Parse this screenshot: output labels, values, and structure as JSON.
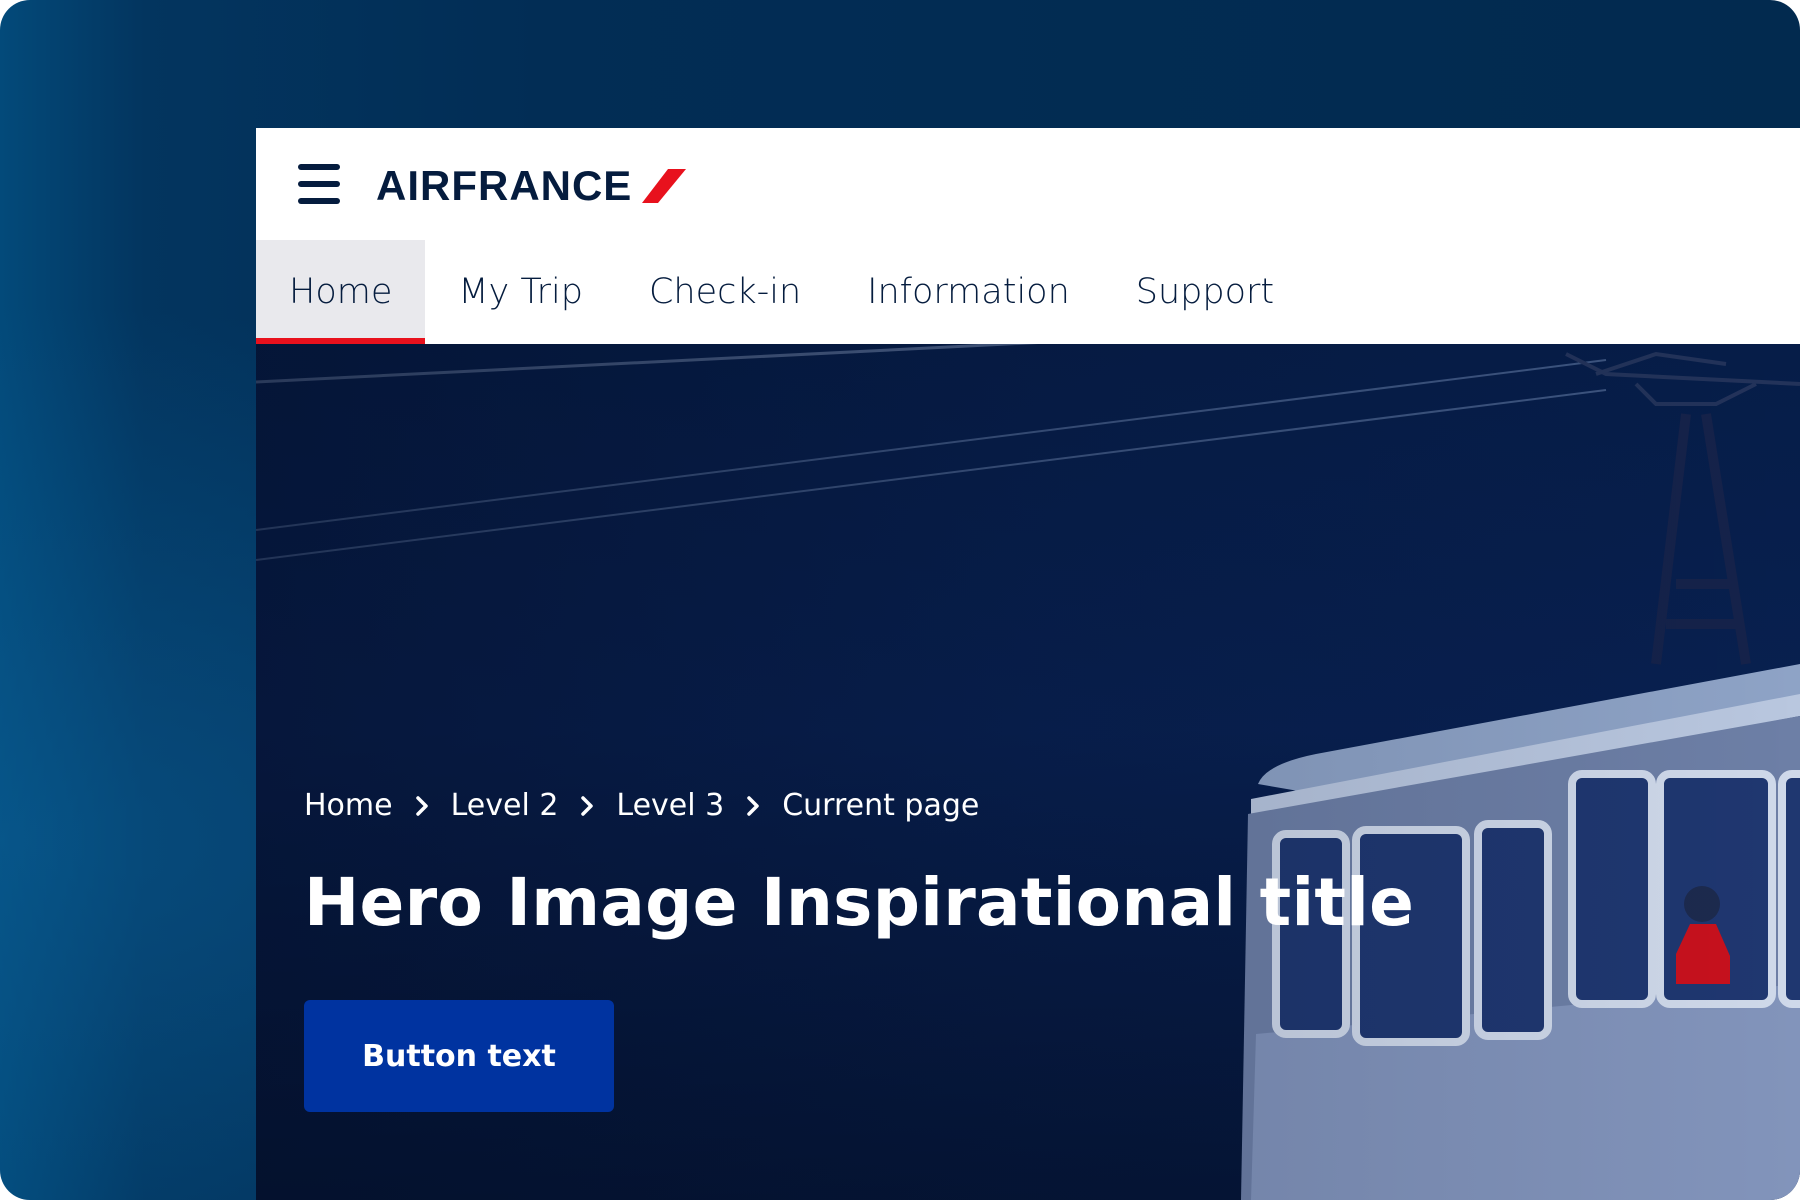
{
  "brand": {
    "name": "AIRFRANCE",
    "accent_color": "#e8111d",
    "navy_color": "#051c3e",
    "button_color": "#0033a0"
  },
  "header": {
    "menu_icon": "hamburger-icon",
    "nav_items": [
      {
        "label": "Home",
        "active": true
      },
      {
        "label": "My Trip",
        "active": false
      },
      {
        "label": "Check-in",
        "active": false
      },
      {
        "label": "Information",
        "active": false
      },
      {
        "label": "Support",
        "active": false
      }
    ]
  },
  "hero": {
    "breadcrumb": [
      {
        "label": "Home"
      },
      {
        "label": "Level 2"
      },
      {
        "label": "Level 3"
      },
      {
        "label": "Current page"
      }
    ],
    "separator_icon": "chevron-right-icon",
    "title": "Hero Image Inspirational title",
    "button_label": "Button text"
  }
}
